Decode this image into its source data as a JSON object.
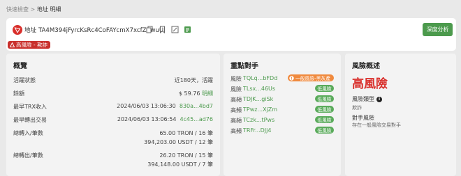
{
  "breadcrumb": {
    "root": "快速檢查",
    "sep": " > ",
    "current": "地址 明細"
  },
  "header": {
    "address_label": "地址",
    "address": "TA4M394jFyrcKsRc4CoFAYcmX7xcfZZwuU",
    "deep_button": "深度分析",
    "risk_pill": "高風險 - 欺詐",
    "icons": [
      "tron-logo-icon",
      "copy-icon",
      "bookmark-icon",
      "edit-icon",
      "export-icon"
    ]
  },
  "overview": {
    "title": "概覽",
    "rows": [
      {
        "label": "活躍狀態",
        "value": "近180天，活躍",
        "link": ""
      },
      {
        "label": "餘額",
        "value": "$ 59.76",
        "link": "明細"
      },
      {
        "label": "最早TRX收入",
        "value": "2024/06/03 13:06:30",
        "link": "830a...4bd7"
      },
      {
        "label": "最早轉出交易",
        "value": "2024/06/03 13:06:54",
        "link": "4c45...ad76"
      }
    ],
    "in_label": "總轉入/筆數",
    "in_values": [
      "65.00 TRON / 16 筆",
      "394,203.00 USDT / 12 筆"
    ],
    "out_label": "總轉出/筆數",
    "out_values": [
      "26.20 TRON / 15 筆",
      "394,148.00 USDT / 7 筆"
    ]
  },
  "counterparties": {
    "title": "重點對手",
    "rows": [
      {
        "level": "風險",
        "addr": "TQLq...bFDd",
        "tag": "一般風險-黑灰產",
        "tag_type": "orange"
      },
      {
        "level": "風險",
        "addr": "TLsx...46Us",
        "tag": "低風險",
        "tag_type": "low"
      },
      {
        "level": "高頻",
        "addr": "TDJK...giSk",
        "tag": "低風險",
        "tag_type": "low"
      },
      {
        "level": "高頻",
        "addr": "TPwz...XjZm",
        "tag": "低風險",
        "tag_type": "low"
      },
      {
        "level": "高頻",
        "addr": "TCzk...tPws",
        "tag": "低風險",
        "tag_type": "low"
      },
      {
        "level": "高頻",
        "addr": "TRFr...DJj4",
        "tag": "低風險",
        "tag_type": "low"
      }
    ]
  },
  "risk": {
    "title": "風險概述",
    "level": "高風險",
    "type_label": "風險類型",
    "type_value": "欺詐",
    "cp_label": "對手風險",
    "cp_value": "存在一般風險交易對手"
  },
  "colors": {
    "green": "#4c9a4d",
    "red": "#d9302c",
    "orange": "#f08a3e"
  }
}
